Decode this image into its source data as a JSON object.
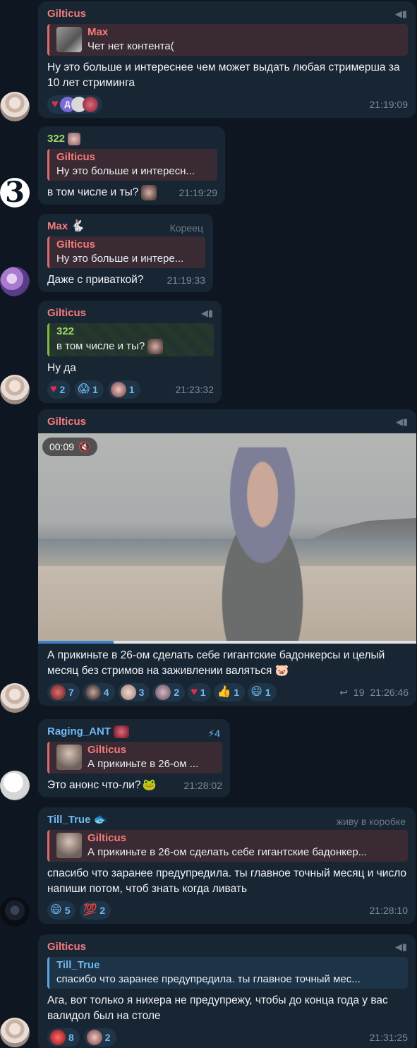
{
  "messages": [
    {
      "sender": "Gilticus",
      "reply": {
        "name": "Max",
        "text": "Чет нет контента("
      },
      "text": "Ну это больше и интереснее чем может выдать любая стримерша за 10 лет стриминга",
      "reactions": [
        {
          "emoji": "♥",
          "count": ""
        },
        {
          "emoji": "Д",
          "count": ""
        }
      ],
      "time": "21:19:09"
    },
    {
      "sender": "322",
      "reply": {
        "name": "Gilticus",
        "text": "Ну это больше и интересн..."
      },
      "text": "в том числе и ты?",
      "time": "21:19:29"
    },
    {
      "sender": "Max",
      "badge": "Кореец",
      "reply": {
        "name": "Gilticus",
        "text": "Ну это больше и интере..."
      },
      "text": "Даже с приваткой?",
      "time": "21:19:33"
    },
    {
      "sender": "Gilticus",
      "reply": {
        "name": "322",
        "text": "в том числе и ты?"
      },
      "text": "Ну да",
      "reactions": [
        {
          "emoji": "♥",
          "count": "2"
        },
        {
          "emoji": "😱",
          "count": "1"
        },
        {
          "emoji": "",
          "count": "1"
        }
      ],
      "time": "21:23:32"
    },
    {
      "sender": "Gilticus",
      "video_duration": "00:09",
      "video_progress": 0.2,
      "text": "А прикиньте в 26-ом сделать себе гигантские бадонкерсы и целый месяц без стримов на заживлении валяться",
      "reactions": [
        {
          "emoji": "",
          "count": "7"
        },
        {
          "emoji": "",
          "count": "4"
        },
        {
          "emoji": "",
          "count": "3"
        },
        {
          "emoji": "",
          "count": "2"
        },
        {
          "emoji": "♥",
          "count": "1"
        },
        {
          "emoji": "👍",
          "count": "1"
        },
        {
          "emoji": "😄",
          "count": "1"
        }
      ],
      "forwards": "19",
      "time": "21:26:46"
    },
    {
      "sender": "Raging_ANT",
      "boost": "4",
      "reply": {
        "name": "Gilticus",
        "text": "А прикиньте в 26-ом ..."
      },
      "text": "Это анонс что-ли?",
      "time": "21:28:02"
    },
    {
      "sender": "Till_True",
      "badge": "живу в коробке",
      "reply": {
        "name": "Gilticus",
        "text": "А прикиньте в 26-ом сделать себе гигантские бадонкер..."
      },
      "text": "спасибо что заранее предупредила. ты главное точный месяц и число напиши потом, чтоб знать когда ливать",
      "reactions": [
        {
          "emoji": "😄",
          "count": "5"
        },
        {
          "emoji": "💯",
          "count": "2"
        }
      ],
      "time": "21:28:10"
    },
    {
      "sender": "Gilticus",
      "reply": {
        "name": "Till_True",
        "text": "спасибо что заранее предупредила. ты главное точный мес..."
      },
      "text": "Ага, вот только я нихера не предупрежу, чтобы до конца года у вас валидол был на столе",
      "reactions": [
        {
          "emoji": "",
          "count": "8"
        },
        {
          "emoji": "",
          "count": "2"
        }
      ],
      "time": "21:31:25"
    }
  ],
  "avatars": {
    "322": "3"
  },
  "icons": {
    "pin": "megaphone-icon",
    "mute": "speaker-muted-icon",
    "forward": "share-arrow-icon",
    "boost": "lightning-icon"
  }
}
